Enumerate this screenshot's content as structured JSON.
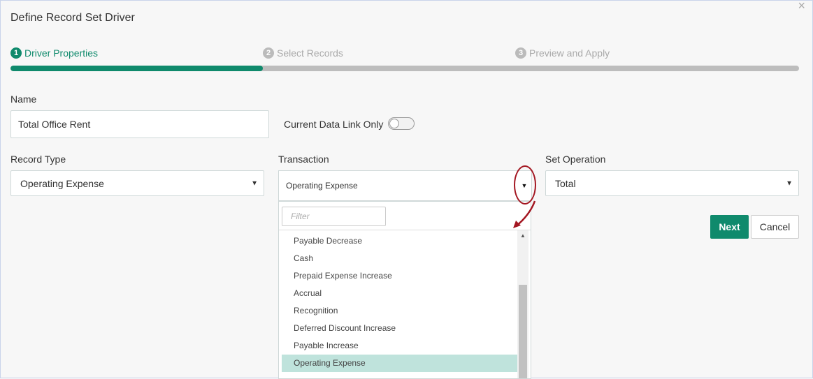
{
  "dialog": {
    "title": "Define Record Set Driver",
    "close_label": "×"
  },
  "wizard": {
    "steps": [
      {
        "num": "1",
        "label": "Driver Properties",
        "state": "active"
      },
      {
        "num": "2",
        "label": "Select Records",
        "state": "inactive"
      },
      {
        "num": "3",
        "label": "Preview and Apply",
        "state": "inactive"
      }
    ],
    "progress_fraction": 0.32
  },
  "form": {
    "name_label": "Name",
    "name_value": "Total Office Rent",
    "current_link_label": "Current Data Link Only",
    "current_link_on": false,
    "record_type_label": "Record Type",
    "record_type_value": "Operating Expense",
    "transaction_label": "Transaction",
    "transaction_value": "Operating Expense",
    "set_operation_label": "Set Operation",
    "set_operation_value": "Total"
  },
  "transaction_dropdown": {
    "filter_placeholder": "Filter",
    "options": [
      "Payable Decrease",
      "Cash",
      "Prepaid Expense Increase",
      "Accrual",
      "Recognition",
      "Deferred Discount Increase",
      "Payable Increase",
      "Operating Expense"
    ],
    "selected_index": 7
  },
  "buttons": {
    "next": "Next",
    "cancel": "Cancel"
  },
  "colors": {
    "accent": "#0f8a6c",
    "selected_option": "#bfe3dc",
    "annotation": "#a31621"
  }
}
